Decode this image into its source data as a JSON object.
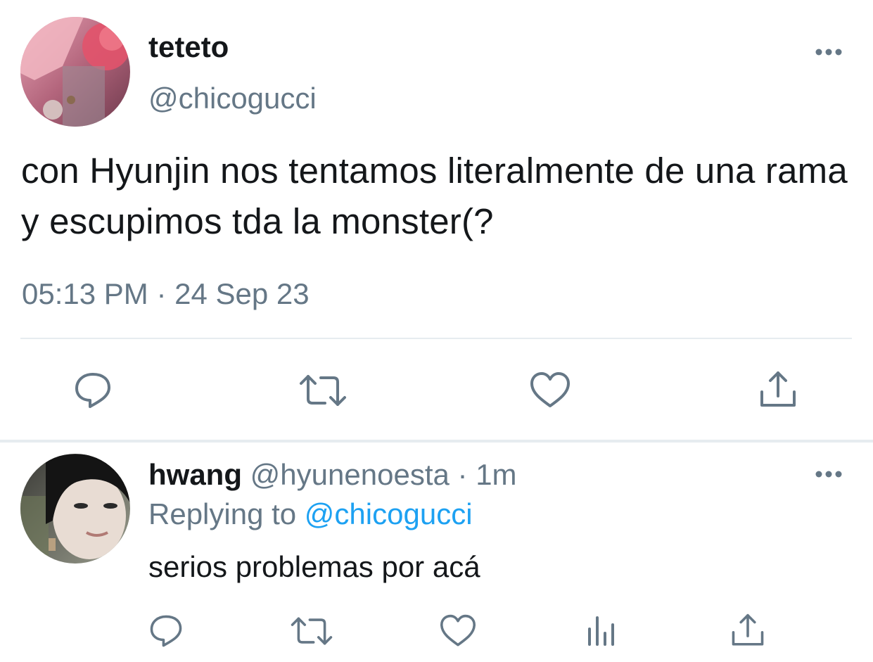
{
  "main_tweet": {
    "display_name": "teteto",
    "handle": "@chicogucci",
    "text": "con Hyunjin nos tentamos literalmente de una rama y escupimos tda la monster(?",
    "timestamp": "05:13 PM · 24 Sep 23",
    "actions": [
      "reply-icon",
      "retweet-icon",
      "like-icon",
      "share-icon"
    ],
    "more_icon": "more-horizontal-icon"
  },
  "reply_tweet": {
    "display_name": "hwang",
    "handle": "@hyunenoesta",
    "separator": "·",
    "time_ago": "1m",
    "replying_prefix": "Replying to",
    "replying_handle": "@chicogucci",
    "text": "serios problemas por acá",
    "actions": [
      "reply-icon",
      "retweet-icon",
      "like-icon",
      "analytics-icon",
      "share-icon"
    ],
    "more_icon": "more-horizontal-icon"
  },
  "colors": {
    "text_primary": "#14171a",
    "text_secondary": "#657786",
    "link": "#1da1f2",
    "divider": "#e6ecf0"
  }
}
